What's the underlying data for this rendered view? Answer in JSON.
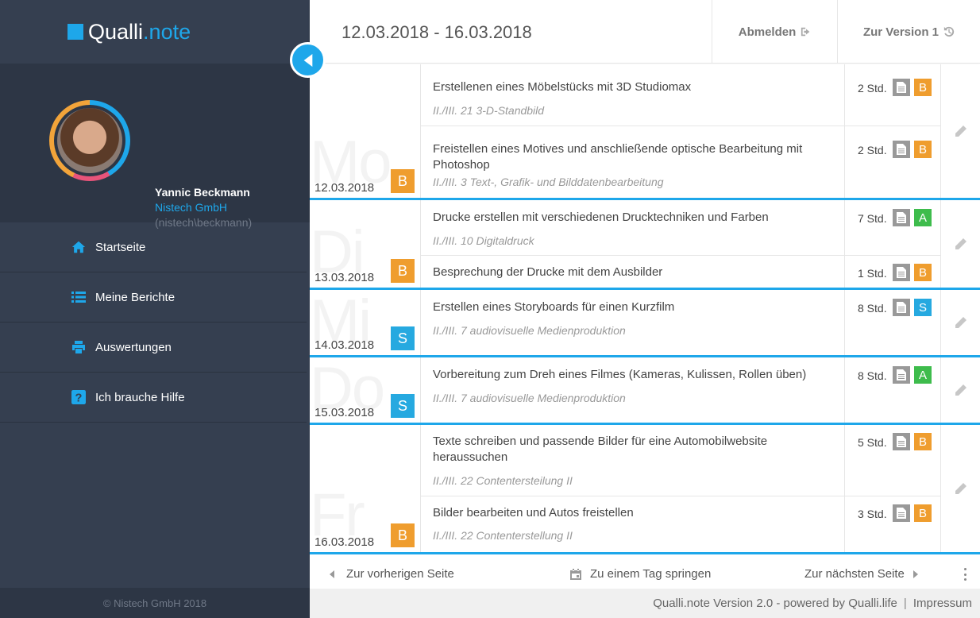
{
  "app": {
    "logo_main": "Qualli",
    "logo_dot": ".",
    "logo_suffix": "note"
  },
  "user": {
    "name": "Yannic Beckmann",
    "company": "Nistech GmbH",
    "login": "(nistech\\beckmann)"
  },
  "nav": [
    {
      "label": "Startseite",
      "icon": "home-icon"
    },
    {
      "label": "Meine Berichte",
      "icon": "list-icon"
    },
    {
      "label": "Auswertungen",
      "icon": "print-icon"
    },
    {
      "label": "Ich brauche Hilfe",
      "icon": "help-icon"
    }
  ],
  "sidebar_footer": "© Nistech GmbH 2018",
  "header": {
    "date_range": "12.03.2018 - 16.03.2018",
    "logout_label": "Abmelden",
    "version_label": "Zur Version 1"
  },
  "colors": {
    "accent": "#1ea7ea",
    "badge_B": "#ef9d2e",
    "badge_A": "#3ebc4c",
    "badge_S": "#26a9e0"
  },
  "days": [
    {
      "watermark": "Mo",
      "date": "12.03.2018",
      "badge": "B",
      "entries": [
        {
          "title": "Erstellenen eines Möbelstücks mit 3D Studiomax",
          "subtitle": "II./III. 21 3-D-Standbild",
          "hours": "2 Std.",
          "category": "B"
        },
        {
          "title": "Freistellen eines Motives und anschließende optische Bearbeitung mit Photoshop",
          "subtitle": "II./III. 3 Text-, Grafik- und Bilddatenbearbeitung",
          "hours": "2 Std.",
          "category": "B"
        }
      ]
    },
    {
      "watermark": "Di",
      "date": "13.03.2018",
      "badge": "B",
      "entries": [
        {
          "title": "Drucke erstellen mit verschiedenen Drucktechniken und Farben",
          "subtitle": "II./III. 10 Digitaldruck",
          "hours": "7 Std.",
          "category": "A"
        },
        {
          "title": "Besprechung der Drucke mit dem Ausbilder",
          "subtitle": "",
          "hours": "1 Std.",
          "category": "B"
        }
      ]
    },
    {
      "watermark": "Mi",
      "date": "14.03.2018",
      "badge": "S",
      "entries": [
        {
          "title": "Erstellen eines Storyboards für einen Kurzfilm",
          "subtitle": "II./III. 7 audiovisuelle Medienproduktion",
          "hours": "8 Std.",
          "category": "S"
        }
      ]
    },
    {
      "watermark": "Do",
      "date": "15.03.2018",
      "badge": "S",
      "entries": [
        {
          "title": "Vorbereitung zum Dreh eines Filmes (Kameras, Kulissen, Rollen üben)",
          "subtitle": "II./III. 7 audiovisuelle Medienproduktion",
          "hours": "8 Std.",
          "category": "A"
        }
      ]
    },
    {
      "watermark": "Fr",
      "date": "16.03.2018",
      "badge": "B",
      "entries": [
        {
          "title": "Texte schreiben und passende Bilder für eine Automobilwebsite heraussuchen",
          "subtitle": "II./III. 22 Contentersteilung II",
          "hours": "5 Std.",
          "category": "B"
        },
        {
          "title": "Bilder bearbeiten und Autos freistellen",
          "subtitle": "II./III. 22 Contenterstellung II",
          "hours": "3 Std.",
          "category": "B"
        }
      ]
    }
  ],
  "pager": {
    "prev": "Zur vorherigen Seite",
    "jump": "Zu einem Tag springen",
    "next": "Zur nächsten Seite"
  },
  "footer": {
    "version_text": "Qualli.note Version 2.0 - powered by Qualli.life",
    "separator": "|",
    "impressum": "Impressum"
  }
}
